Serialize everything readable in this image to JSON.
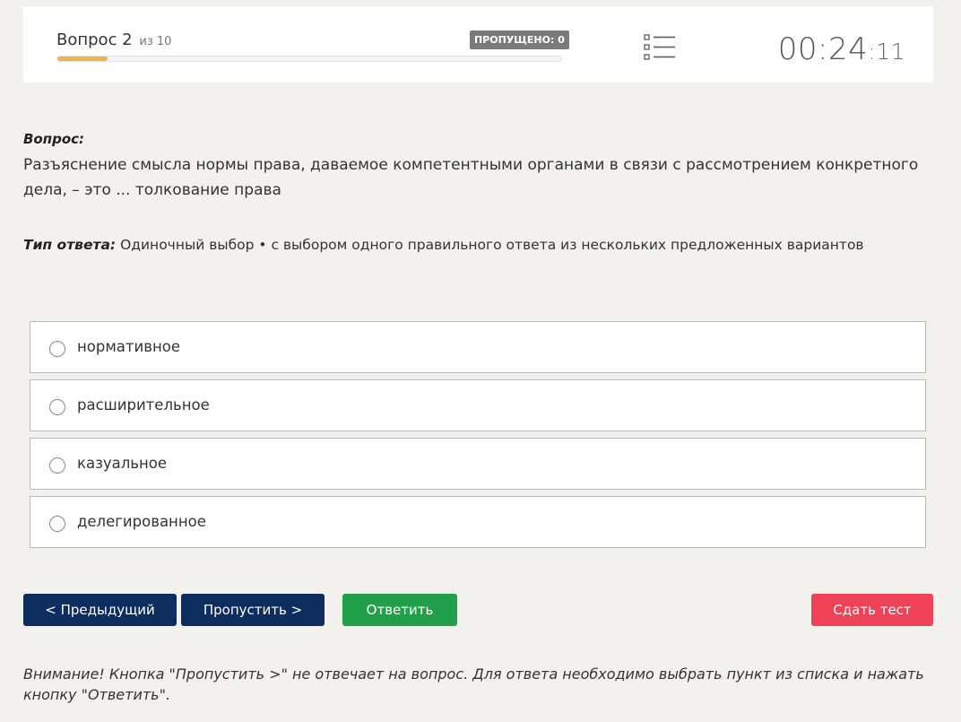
{
  "header": {
    "question_label": "Вопрос 2",
    "question_of": "из 10",
    "progress_fraction": 0.1,
    "skipped_badge": "ПРОПУЩЕНО: 0",
    "timer_main": "00:24",
    "timer_seconds": ":11",
    "list_icon": "list-icon",
    "colors": {
      "progress": "#f0b545",
      "badge": "#7a7a7a"
    }
  },
  "question": {
    "label": "Вопрос:",
    "text": "Разъяснение смысла нормы права, даваемое компетентными органами в связи с рассмотрением конкретного дела, – это ... толкование права",
    "answer_type_label": "Тип ответа:",
    "answer_type_value": " Одиночный выбор • с выбором одного правильного ответа из нескольких предложенных вариантов"
  },
  "options": [
    {
      "label": "нормативное"
    },
    {
      "label": "расширительное"
    },
    {
      "label": "казуальное"
    },
    {
      "label": "делегированное"
    }
  ],
  "buttons": {
    "prev": "< Предыдущий",
    "skip": "Пропустить >",
    "answer": "Ответить",
    "submit": "Сдать тест",
    "colors": {
      "nav": "#0c2d5e",
      "answer": "#21a04a",
      "submit": "#f04256"
    }
  },
  "notice": "Внимание! Кнопка \"Пропустить >\" не отвечает на вопрос. Для ответа необходимо выбрать пункт из списка и нажать кнопку \"Ответить\"."
}
